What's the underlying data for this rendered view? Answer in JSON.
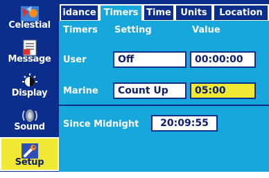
{
  "sidebar": {
    "items": [
      {
        "label": "Celestial",
        "icon": "celestial-icon",
        "active": false
      },
      {
        "label": "Message",
        "icon": "message-icon",
        "active": false
      },
      {
        "label": "Display",
        "icon": "display-icon",
        "active": false
      },
      {
        "label": "Sound",
        "icon": "sound-icon",
        "active": false
      },
      {
        "label": "Setup",
        "icon": "setup-icon",
        "active": true
      }
    ]
  },
  "tabs": [
    {
      "label": "idance",
      "active": false
    },
    {
      "label": "Timers",
      "active": true
    },
    {
      "label": "Time",
      "active": false
    },
    {
      "label": "Units",
      "active": false
    },
    {
      "label": "Location",
      "active": false
    }
  ],
  "headers": {
    "col1": "Timers",
    "col2": "Setting",
    "col3": "Value"
  },
  "rows": {
    "user": {
      "label": "User",
      "setting": "Off",
      "value": "00:00:00"
    },
    "marine": {
      "label": "Marine",
      "setting": "Count Up",
      "value": "05:00"
    },
    "since_midnight": {
      "label": "Since Midnight",
      "value": "20:09:55"
    }
  },
  "colors": {
    "background": "#0b2e8c",
    "panel": "#16a8dc",
    "active_accent": "#f0e832",
    "field_bg": "#ffffff"
  }
}
